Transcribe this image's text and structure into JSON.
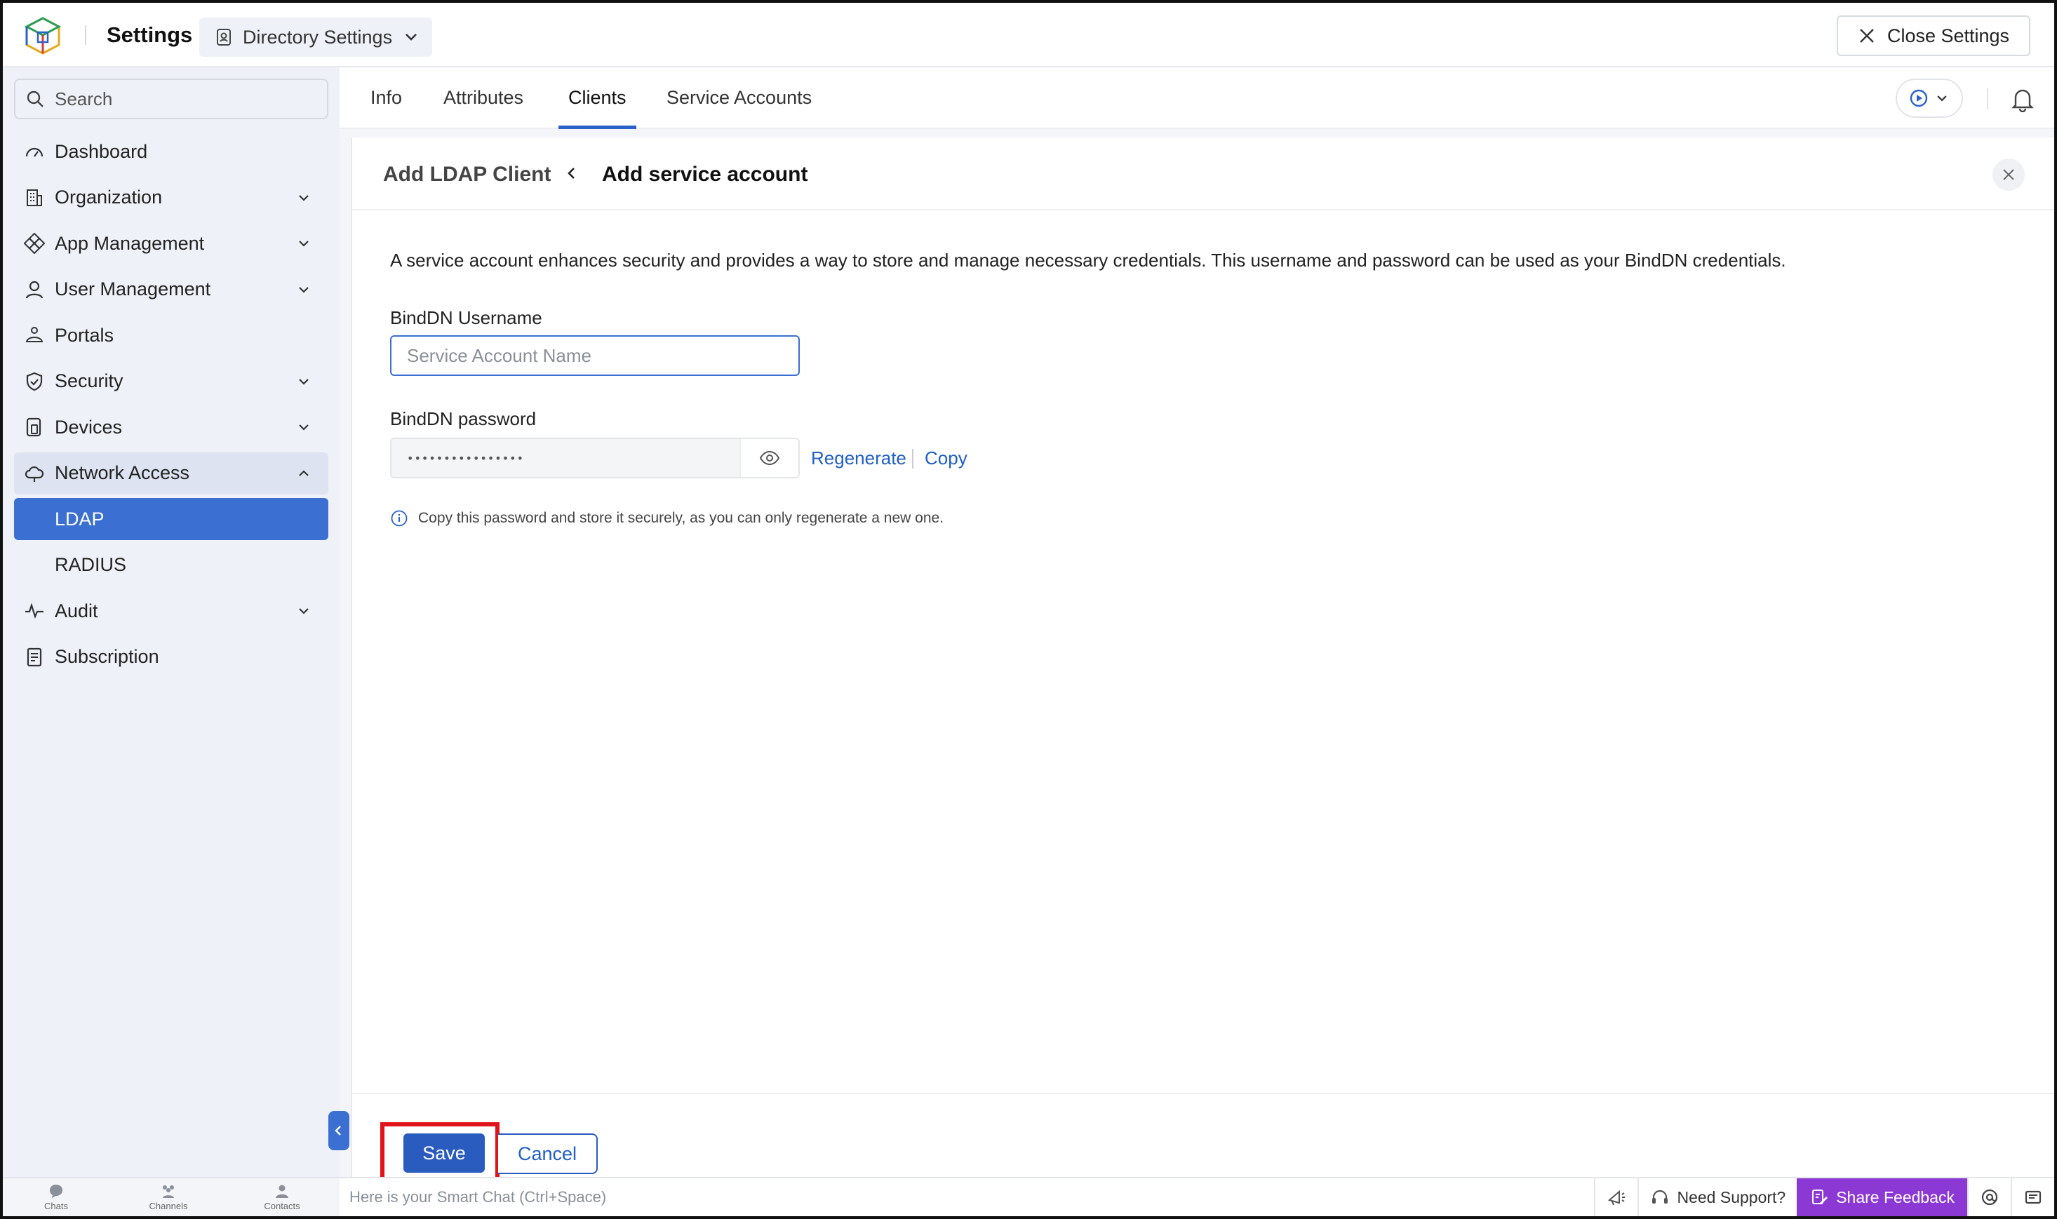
{
  "app": {
    "title": "Settings"
  },
  "header": {
    "directory_select": "Directory Settings",
    "close_settings": "Close Settings"
  },
  "sidebar": {
    "search_placeholder": "Search",
    "items": [
      {
        "label": "Dashboard",
        "icon": "dashboard-icon"
      },
      {
        "label": "Organization",
        "icon": "building-icon",
        "expandable": true
      },
      {
        "label": "App Management",
        "icon": "apps-icon",
        "expandable": true
      },
      {
        "label": "User Management",
        "icon": "user-icon",
        "expandable": true
      },
      {
        "label": "Portals",
        "icon": "portal-icon"
      },
      {
        "label": "Security",
        "icon": "shield-icon",
        "expandable": true
      },
      {
        "label": "Devices",
        "icon": "devices-icon",
        "expandable": true
      },
      {
        "label": "Network Access",
        "icon": "cloud-icon",
        "expandable": true,
        "expanded": true
      },
      {
        "label": "LDAP",
        "sub": true,
        "active": true
      },
      {
        "label": "RADIUS",
        "sub": true
      },
      {
        "label": "Audit",
        "icon": "pulse-icon",
        "expandable": true
      },
      {
        "label": "Subscription",
        "icon": "document-icon"
      }
    ]
  },
  "tabs": [
    {
      "label": "Info"
    },
    {
      "label": "Attributes"
    },
    {
      "label": "Clients",
      "active": true
    },
    {
      "label": "Service Accounts"
    }
  ],
  "panel": {
    "breadcrumb_parent": "Add LDAP Client",
    "breadcrumb_current": "Add service account",
    "description": "A service account enhances security and provides a way to store and manage necessary credentials. This username and password can be used as your BindDN credentials.",
    "username_label": "BindDN Username",
    "username_placeholder": "Service Account Name",
    "username_value": "",
    "password_label": "BindDN password",
    "password_value": "••••••••••••••••",
    "regenerate": "Regenerate",
    "copy": "Copy",
    "note": "Copy this password and store it securely, as you can only regenerate a new one.",
    "save": "Save",
    "cancel": "Cancel"
  },
  "bottombar": {
    "chats": "Chats",
    "channels": "Channels",
    "contacts": "Contacts",
    "smartchat": "Here is your Smart Chat (Ctrl+Space)",
    "need_support": "Need Support?",
    "share_feedback": "Share Feedback"
  },
  "colors": {
    "accent": "#3b6fd1",
    "primary_button": "#2a5bbe",
    "link": "#1f5fc6",
    "highlight": "#e0141b",
    "share_feedback": "#8c38d4",
    "sidebar_bg": "#eef1f7"
  }
}
